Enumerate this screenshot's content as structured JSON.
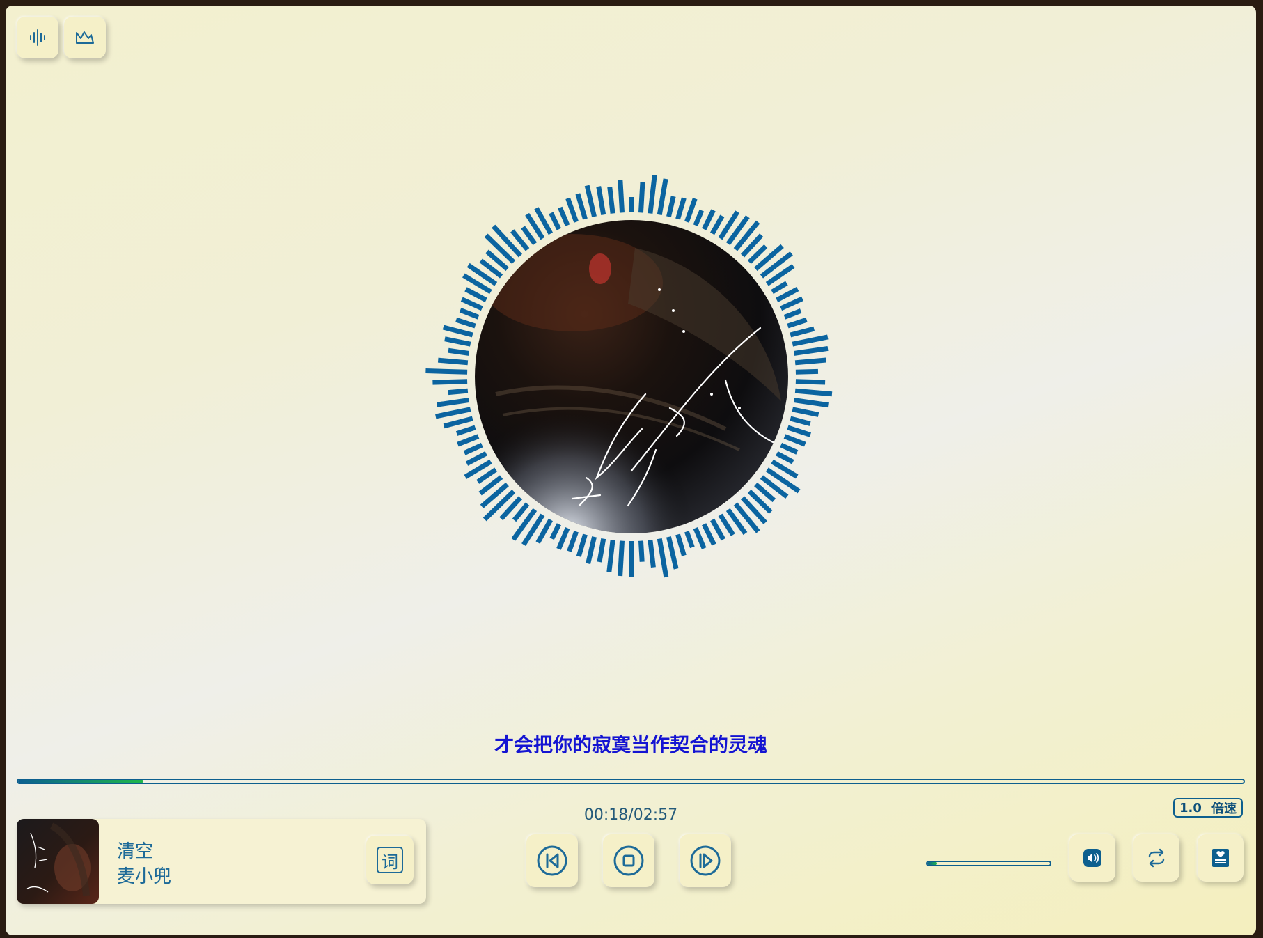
{
  "toolbar": {
    "visualizer_icon": "waveform-icon",
    "background_icon": "mountain-image-icon"
  },
  "now_playing": {
    "title": "清空",
    "artist": "麦小兜",
    "lyric_line": "才会把你的寂寞当作契合的灵魂"
  },
  "playback": {
    "current_time": "00:18",
    "total_time": "02:57",
    "time_display": "00:18/02:57",
    "progress": 0.102,
    "speed_value": "1.0",
    "speed_label": "倍速",
    "volume": 0.08
  },
  "controls": {
    "lyrics_button_label": "词",
    "previous_icon": "previous-track-icon",
    "stop_icon": "stop-icon",
    "next_icon": "next-track-icon",
    "volume_icon": "speaker-icon",
    "repeat_icon": "repeat-icon",
    "playlist_icon": "playlist-heart-icon"
  },
  "colors": {
    "accent": "#0d5f8e",
    "bars": "#0b64a0",
    "lyric": "#1414d2",
    "progress_end": "#1fb64a"
  }
}
